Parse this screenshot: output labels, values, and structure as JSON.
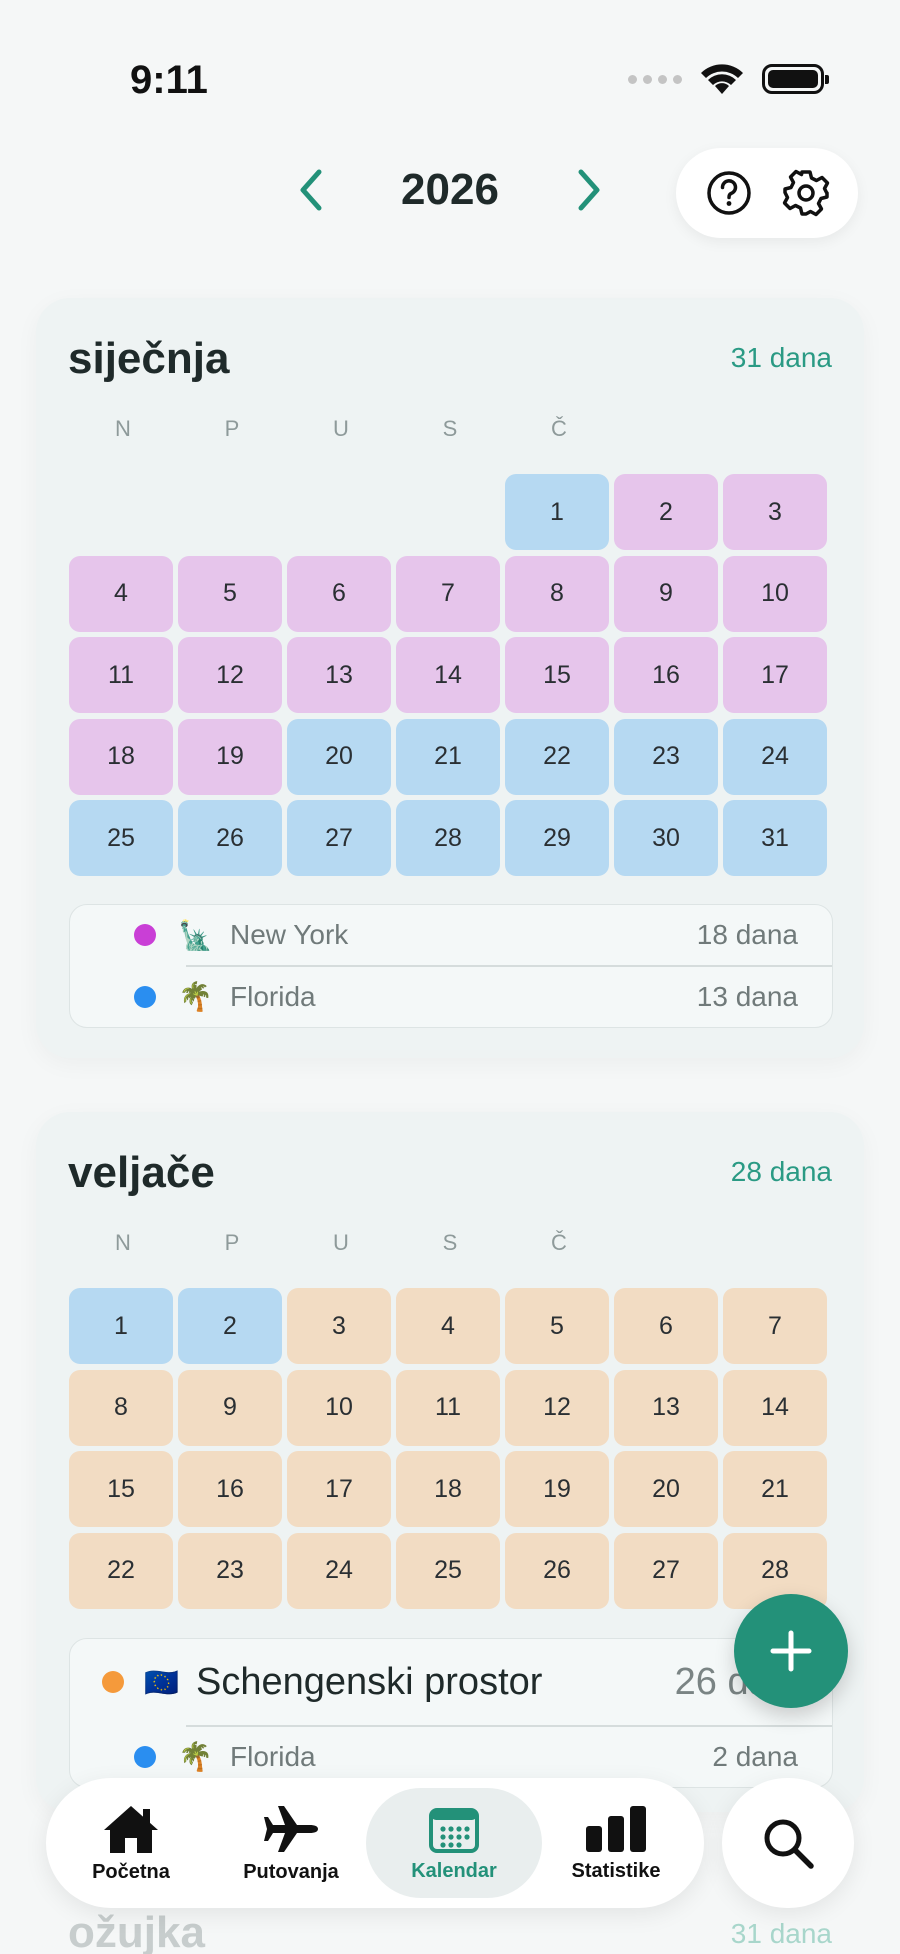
{
  "status": {
    "time": "9:11"
  },
  "header": {
    "year": "2026"
  },
  "icons": {
    "prev": "chevron-left-icon",
    "next": "chevron-right-icon",
    "help": "question-icon",
    "settings": "gear-icon",
    "add": "plus-icon",
    "search": "search-icon"
  },
  "colors": {
    "accent": "#239179",
    "new_york": "#c93fd6",
    "florida": "#2a8ef0",
    "schengen": "#f59a3b",
    "cell_pink": "#e6c5eb",
    "cell_blue": "#b6d9f2",
    "cell_orange": "#f2dcc3"
  },
  "months": [
    {
      "name": "siječnja",
      "days_label": "31 dana",
      "weekdays": [
        "N",
        "P",
        "U",
        "S",
        "Č",
        "",
        ""
      ],
      "offset": 4,
      "day_colors": [
        "blue",
        "pink",
        "pink",
        "pink",
        "pink",
        "pink",
        "pink",
        "pink",
        "pink",
        "pink",
        "pink",
        "pink",
        "pink",
        "pink",
        "pink",
        "pink",
        "pink",
        "pink",
        "pink",
        "blue",
        "blue",
        "blue",
        "blue",
        "blue",
        "blue",
        "blue",
        "blue",
        "blue",
        "blue",
        "blue",
        "blue"
      ],
      "legend": [
        {
          "color": "#c93fd6",
          "emoji": "🗽",
          "name": "New York",
          "count": "18 dana"
        },
        {
          "color": "#2a8ef0",
          "emoji": "🌴",
          "name": "Florida",
          "count": "13 dana"
        }
      ]
    },
    {
      "name": "veljače",
      "days_label": "28 dana",
      "weekdays": [
        "N",
        "P",
        "U",
        "S",
        "Č",
        "",
        ""
      ],
      "offset": 0,
      "day_colors": [
        "blue",
        "blue",
        "orange",
        "orange",
        "orange",
        "orange",
        "orange",
        "orange",
        "orange",
        "orange",
        "orange",
        "orange",
        "orange",
        "orange",
        "orange",
        "orange",
        "orange",
        "orange",
        "orange",
        "orange",
        "orange",
        "orange",
        "orange",
        "orange",
        "orange",
        "orange",
        "orange",
        "orange"
      ],
      "legend": [
        {
          "color": "#f59a3b",
          "emoji": "🇪🇺",
          "name": "Schengenski prostor",
          "count": "26 dana",
          "big": true
        },
        {
          "color": "#2a8ef0",
          "emoji": "🌴",
          "name": "Florida",
          "count": "2 dana"
        }
      ]
    }
  ],
  "next_month": {
    "name": "ožujka",
    "days_label": "31 dana"
  },
  "tabs": [
    {
      "label": "Početna",
      "icon": "home-icon",
      "active": false
    },
    {
      "label": "Putovanja",
      "icon": "airplane-icon",
      "active": false
    },
    {
      "label": "Kalendar",
      "icon": "calendar-icon",
      "active": true
    },
    {
      "label": "Statistike",
      "icon": "bar-chart-icon",
      "active": false
    }
  ]
}
